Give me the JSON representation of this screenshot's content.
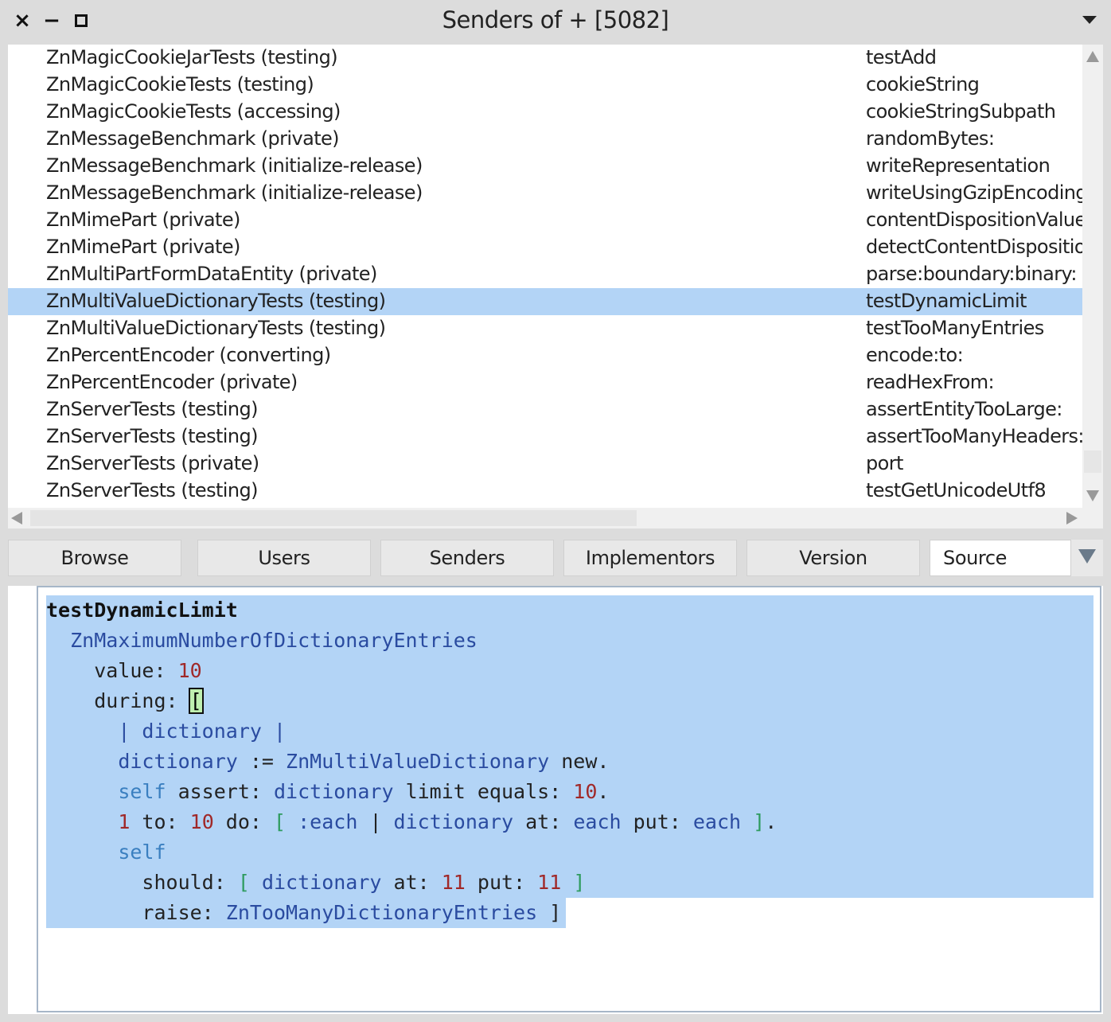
{
  "window": {
    "title": "Senders of + [5082]",
    "close_glyph": "×",
    "minimize_glyph": "−"
  },
  "results": [
    {
      "cls": "ZnMagicCookieJarTests (testing)",
      "sel": "testAdd"
    },
    {
      "cls": "ZnMagicCookieTests (testing)",
      "sel": "cookieString"
    },
    {
      "cls": "ZnMagicCookieTests (accessing)",
      "sel": "cookieStringSubpath"
    },
    {
      "cls": "ZnMessageBenchmark (private)",
      "sel": "randomBytes:"
    },
    {
      "cls": "ZnMessageBenchmark (initialize-release)",
      "sel": "writeRepresentation"
    },
    {
      "cls": "ZnMessageBenchmark (initialize-release)",
      "sel": "writeUsingGzipEncodingAndChunking"
    },
    {
      "cls": "ZnMimePart (private)",
      "sel": "contentDispositionValues"
    },
    {
      "cls": "ZnMimePart (private)",
      "sel": "detectContentDisposition"
    },
    {
      "cls": "ZnMultiPartFormDataEntity (private)",
      "sel": "parse:boundary:binary:"
    },
    {
      "cls": "ZnMultiValueDictionaryTests (testing)",
      "sel": "testDynamicLimit",
      "selected": true
    },
    {
      "cls": "ZnMultiValueDictionaryTests (testing)",
      "sel": "testTooManyEntries"
    },
    {
      "cls": "ZnPercentEncoder (converting)",
      "sel": "encode:to:"
    },
    {
      "cls": "ZnPercentEncoder (private)",
      "sel": "readHexFrom:"
    },
    {
      "cls": "ZnServerTests (testing)",
      "sel": "assertEntityTooLarge:"
    },
    {
      "cls": "ZnServerTests (testing)",
      "sel": "assertTooManyHeaders:"
    },
    {
      "cls": "ZnServerTests (private)",
      "sel": "port"
    },
    {
      "cls": "ZnServerTests (testing)",
      "sel": "testGetUnicodeUtf8"
    }
  ],
  "toolbar": {
    "browse": "Browse",
    "users": "Users",
    "senders": "Senders",
    "implementors": "Implementors",
    "version": "Version",
    "source": "Source"
  },
  "source_lines": [
    [
      {
        "t": "testDynamicLimit",
        "s": "b"
      }
    ],
    [
      {
        "t": "  ",
        "s": "k"
      },
      {
        "t": "ZnMaximumNumberOfDictionaryEntries",
        "s": "c"
      }
    ],
    [
      {
        "t": "    value: ",
        "s": "k"
      },
      {
        "t": "10",
        "s": "n"
      }
    ],
    [
      {
        "t": "    during: ",
        "s": "k"
      },
      {
        "t": "[",
        "s": "brk"
      }
    ],
    [
      {
        "t": "      ",
        "s": "k"
      },
      {
        "t": "| dictionary |",
        "s": "c"
      }
    ],
    [
      {
        "t": "      ",
        "s": "k"
      },
      {
        "t": "dictionary",
        "s": "c"
      },
      {
        "t": " := ",
        "s": "k"
      },
      {
        "t": "ZnMultiValueDictionary",
        "s": "c"
      },
      {
        "t": " new.",
        "s": "k"
      }
    ],
    [
      {
        "t": "      ",
        "s": "k"
      },
      {
        "t": "self",
        "s": "sf"
      },
      {
        "t": " assert: ",
        "s": "k"
      },
      {
        "t": "dictionary",
        "s": "c"
      },
      {
        "t": " limit equals: ",
        "s": "k"
      },
      {
        "t": "10",
        "s": "n"
      },
      {
        "t": ".",
        "s": "k"
      }
    ],
    [
      {
        "t": "      ",
        "s": "k"
      },
      {
        "t": "1",
        "s": "n"
      },
      {
        "t": " to: ",
        "s": "k"
      },
      {
        "t": "10",
        "s": "n"
      },
      {
        "t": " do: ",
        "s": "k"
      },
      {
        "t": "[",
        "s": "g"
      },
      {
        "t": " :each ",
        "s": "c"
      },
      {
        "t": "|",
        "s": "k"
      },
      {
        "t": " dictionary",
        "s": "c"
      },
      {
        "t": " at: ",
        "s": "k"
      },
      {
        "t": "each",
        "s": "c"
      },
      {
        "t": " put: ",
        "s": "k"
      },
      {
        "t": "each",
        "s": "c"
      },
      {
        "t": " ]",
        "s": "g"
      },
      {
        "t": ".",
        "s": "k"
      }
    ],
    [
      {
        "t": "      ",
        "s": "k"
      },
      {
        "t": "self",
        "s": "sf"
      }
    ],
    [
      {
        "t": "        should: ",
        "s": "k"
      },
      {
        "t": "[",
        "s": "g"
      },
      {
        "t": " dictionary",
        "s": "c"
      },
      {
        "t": " at: ",
        "s": "k"
      },
      {
        "t": "11",
        "s": "n"
      },
      {
        "t": " put: ",
        "s": "k"
      },
      {
        "t": "11",
        "s": "n"
      },
      {
        "t": " ]",
        "s": "g"
      }
    ],
    [
      {
        "t": "        raise: ",
        "s": "k"
      },
      {
        "t": "ZnTooManyDictionaryEntries",
        "s": "c"
      },
      {
        "t": " ]",
        "s": "k"
      }
    ]
  ]
}
